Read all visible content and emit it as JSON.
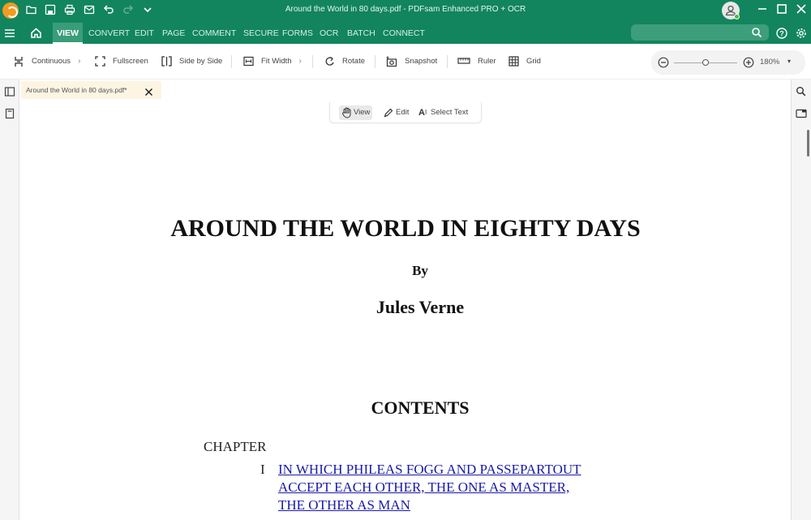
{
  "window": {
    "title": "Around the World in 80 days.pdf  -  PDFsam Enhanced PRO + OCR",
    "quick_access": [
      "open-icon",
      "save-icon",
      "print-icon",
      "email-icon",
      "undo-icon",
      "redo-icon",
      "customize-chevron-icon"
    ]
  },
  "menu": {
    "items": [
      "VIEW",
      "CONVERT",
      "EDIT",
      "PAGE",
      "COMMENT",
      "SECURE",
      "FORMS",
      "OCR",
      "BATCH",
      "CONNECT"
    ],
    "active": "VIEW",
    "search_placeholder": ""
  },
  "toolbar": {
    "continuous": "Continuous",
    "fullscreen": "Fullscreen",
    "side_by_side": "Side by Side",
    "fit_width": "Fit Width",
    "rotate": "Rotate",
    "snapshot": "Snapshot",
    "ruler": "Ruler",
    "grid": "Grid",
    "zoom_level": "180%",
    "zoom_fraction": 0.5
  },
  "document_tab": {
    "label": "Around the World in 80 days.pdf*"
  },
  "mode_bar": {
    "view": "View",
    "edit": "Edit",
    "select_text": "Select Text",
    "active": "View"
  },
  "page": {
    "title": "AROUND THE WORLD IN EIGHTY DAYS",
    "by": "By",
    "author": "Jules Verne",
    "contents_heading": "CONTENTS",
    "chapter_label": "CHAPTER",
    "chapters": [
      {
        "numeral": "I",
        "lines": [
          "IN WHICH PHILEAS FOGG AND PASSEPARTOUT",
          "ACCEPT EACH OTHER, THE ONE AS MASTER,",
          "THE OTHER AS MAN"
        ]
      }
    ]
  },
  "colors": {
    "brand_green": "#12855e",
    "link_blue": "#1a1aa6",
    "tab_bg": "#fdf4e3"
  }
}
